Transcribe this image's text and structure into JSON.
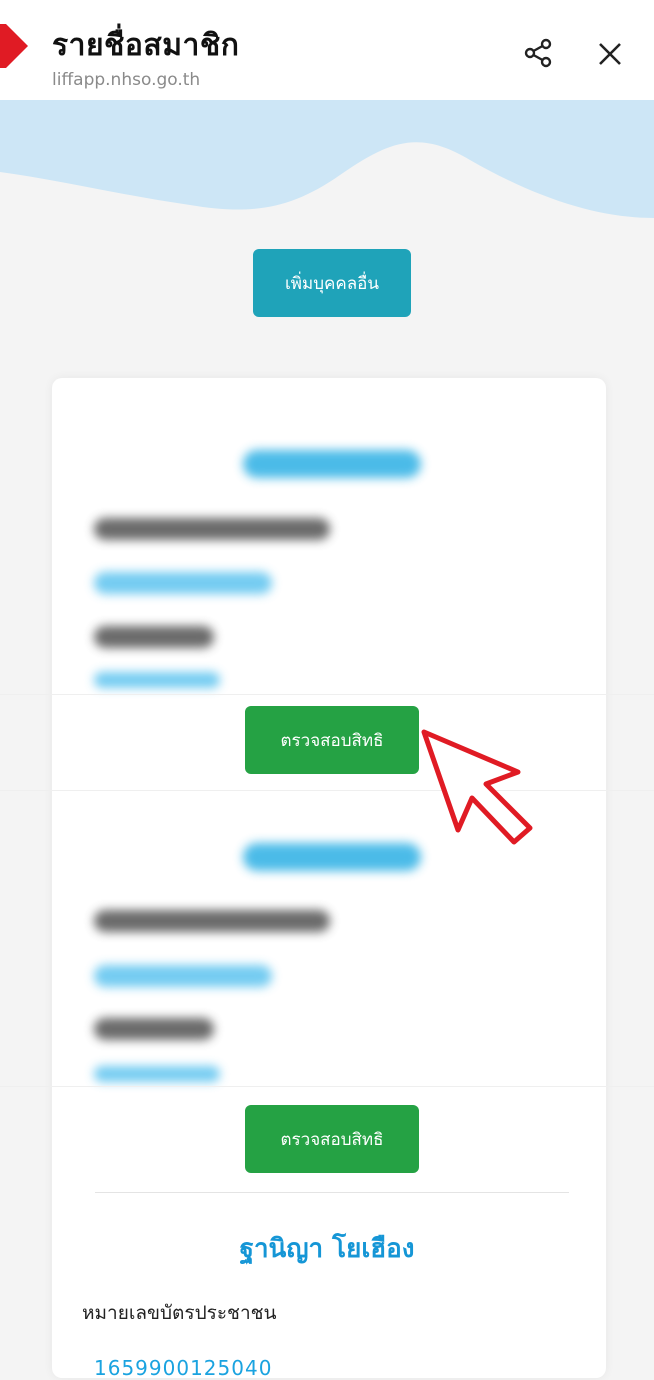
{
  "header": {
    "title": "รายชื่อสมาชิก",
    "url": "liffapp.nhso.go.th"
  },
  "icons": {
    "share": "share-icon",
    "close": "close-icon",
    "cursor": "pointer-arrow-icon"
  },
  "actions": {
    "add_person_label": "เพิ่มบุคคลอื่น",
    "check_rights_label": "ตรวจสอบสิทธิ"
  },
  "member": {
    "name": "ฐานิญา โยเฮือง",
    "id_label": "หมายเลขบัตรประชาชน",
    "id_value": "1659900125040"
  },
  "colors": {
    "accent_teal": "#1fa3b9",
    "check_green": "#25a244",
    "name_blue": "#1596d6",
    "wave_blue": "#cde6f6",
    "cursor_red": "#e01b24"
  }
}
